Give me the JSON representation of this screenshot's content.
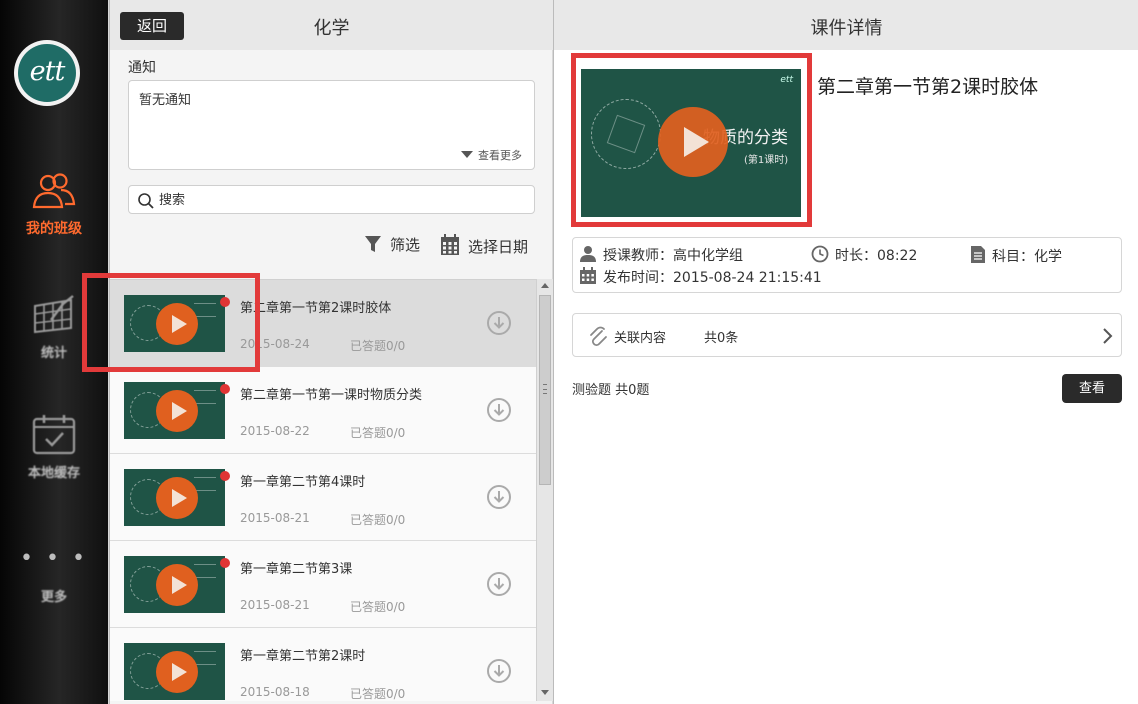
{
  "nav": {
    "logo_text": "ett",
    "items": [
      {
        "label": "我的班级",
        "icon": "people-icon",
        "active": true
      },
      {
        "label": "统计",
        "icon": "chart-icon",
        "active": false
      },
      {
        "label": "本地缓存",
        "icon": "calendar-check-icon",
        "active": false
      },
      {
        "label": "更多",
        "icon": "more-dots-icon",
        "active": false
      }
    ],
    "more_dots": "• • •"
  },
  "mid": {
    "back_label": "返回",
    "title": "化学",
    "notice_label": "通知",
    "notice_text": "暂无通知",
    "see_more": "查看更多",
    "search_placeholder": "搜索",
    "filter_label": "筛选",
    "date_label": "选择日期",
    "lessons": [
      {
        "title": "第二章第一节第2课时胶体",
        "date": "2015-08-24",
        "status": "已答题0/0",
        "selected": true
      },
      {
        "title": "第二章第一节第一课时物质分类",
        "date": "2015-08-22",
        "status": "已答题0/0",
        "selected": false
      },
      {
        "title": "第一章第二节第4课时",
        "date": "2015-08-21",
        "status": "已答题0/0",
        "selected": false
      },
      {
        "title": "第一章第二节第3课",
        "date": "2015-08-21",
        "status": "已答题0/0",
        "selected": false
      },
      {
        "title": "第一章第二节第2课时",
        "date": "2015-08-18",
        "status": "已答题0/0",
        "selected": false
      }
    ]
  },
  "detail": {
    "header_title": "课件详情",
    "course_title": "第二章第一节第2课时胶体",
    "thumb_title": "物质的分类",
    "thumb_sub": "(第1课时)",
    "teacher": "授课教师：高中化学组",
    "duration": "时长：08:22",
    "subject": "科目：化学",
    "publish_time": "发布时间：2015-08-24 21:15:41",
    "related_label": "关联内容",
    "related_count": "共0条",
    "quiz_label": "测验题 共0题",
    "view_label": "查看"
  },
  "colors": {
    "accent": "#ff6a2e",
    "highlight": "#e23a3a",
    "unread_dot": "#e03535",
    "thumb_bg": "#1f5446"
  }
}
